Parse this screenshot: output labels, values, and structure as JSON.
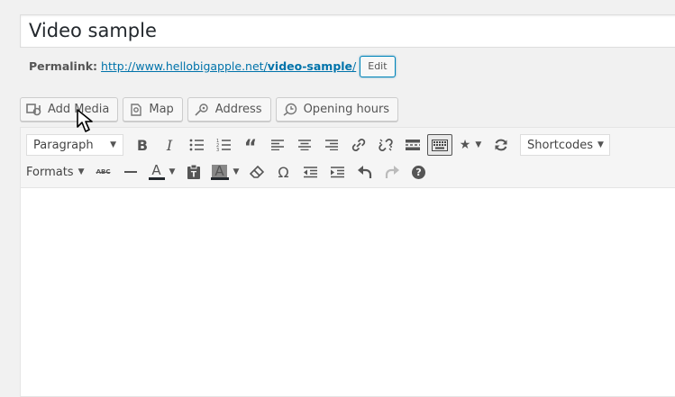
{
  "post": {
    "title": "Video sample",
    "permalink_label": "Permalink:",
    "permalink_base": "http://www.hellobigapple.net/",
    "permalink_slug": "video-sample",
    "permalink_trail": "/",
    "edit_label": "Edit"
  },
  "media_buttons": {
    "add_media": "Add Media",
    "map": "Map",
    "address": "Address",
    "opening_hours": "Opening hours"
  },
  "toolbar": {
    "format_select": "Paragraph",
    "shortcodes_select": "Shortcodes",
    "formats_menu": "Formats",
    "bold": "B",
    "italic": "I",
    "text_color_letter": "A",
    "bg_color_letter": "A",
    "omega": "Ω",
    "help": "?",
    "strike_label": "ABC"
  },
  "colors": {
    "accent": "#0073aa",
    "text_color_bar": "#23282d",
    "bg_color_swatch": "#888888"
  }
}
